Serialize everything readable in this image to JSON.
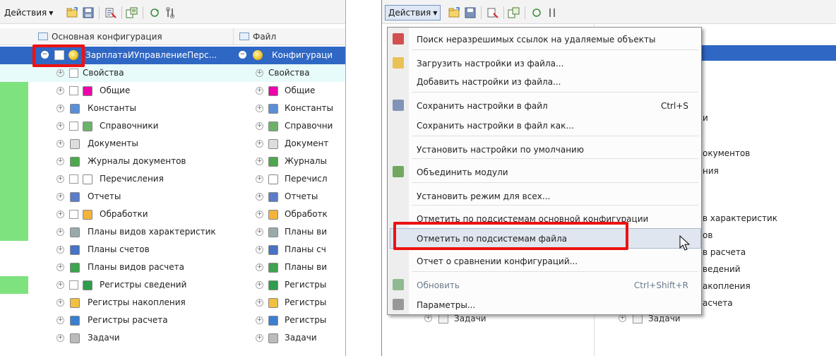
{
  "left": {
    "actions_label": "Действия",
    "col1_header": "Основная конфигурация",
    "col2_header": "Файл",
    "root_left": "ЗарплатаИУправлениеПерс...",
    "root_right": "Конфигураци",
    "rows": [
      {
        "left": "Свойства",
        "right": "Свойства",
        "icon": "properties-icon"
      },
      {
        "left": "Общие",
        "right": "Общие",
        "icon": "common-icon"
      },
      {
        "left": "Константы",
        "right": "Константы",
        "icon": "constants-icon"
      },
      {
        "left": "Справочники",
        "right": "Справочни",
        "icon": "catalogs-icon"
      },
      {
        "left": "Документы",
        "right": "Документ",
        "icon": "documents-icon"
      },
      {
        "left": "Журналы документов",
        "right": "Журналы",
        "icon": "document-journals-icon"
      },
      {
        "left": "Перечисления",
        "right": "Перечисл",
        "icon": "enums-icon"
      },
      {
        "left": "Отчеты",
        "right": "Отчеты",
        "icon": "reports-icon"
      },
      {
        "left": "Обработки",
        "right": "Обработк",
        "icon": "data-processors-icon"
      },
      {
        "left": "Планы видов характеристик",
        "right": "Планы ви",
        "icon": "char-types-icon"
      },
      {
        "left": "Планы счетов",
        "right": "Планы сч",
        "icon": "chart-of-accounts-icon"
      },
      {
        "left": "Планы видов расчета",
        "right": "Планы ви",
        "icon": "calc-types-icon"
      },
      {
        "left": "Регистры сведений",
        "right": "Регистры",
        "icon": "info-registers-icon"
      },
      {
        "left": "Регистры накопления",
        "right": "Регистры",
        "icon": "accum-registers-icon"
      },
      {
        "left": "Регистры расчета",
        "right": "Регистры",
        "icon": "calc-registers-icon"
      },
      {
        "left": "Задачи",
        "right": "Задачи",
        "icon": "tasks-icon"
      }
    ]
  },
  "right": {
    "actions_label": "Действия",
    "bg_fragments": [
      "и",
      "окументов",
      "ния",
      "в характеристик",
      "ов",
      "в расчета",
      "ведений",
      "акопления",
      "асчета"
    ],
    "bottom_row": "Задачи"
  },
  "menu": {
    "items": [
      {
        "label": "Поиск неразрешимых ссылок на удаляемые объекты",
        "shortcut": ""
      },
      {
        "label": "Загрузить настройки из файла...",
        "shortcut": ""
      },
      {
        "label": "Добавить настройки из файла...",
        "shortcut": ""
      },
      {
        "label": "Сохранить настройки в файл",
        "shortcut": "Ctrl+S"
      },
      {
        "label": "Сохранить настройки в файл как...",
        "shortcut": ""
      },
      {
        "label": "Установить настройки по умолчанию",
        "shortcut": ""
      },
      {
        "label": "Объединить модули",
        "shortcut": ""
      },
      {
        "label": "Установить режим для всех...",
        "shortcut": ""
      },
      {
        "label": "Отметить по подсистемам основной конфигурации",
        "shortcut": ""
      },
      {
        "label": "Отметить по подсистемам файла",
        "shortcut": ""
      },
      {
        "label": "Отчет о сравнении конфигураций...",
        "shortcut": ""
      },
      {
        "label": "Обновить",
        "shortcut": "Ctrl+Shift+R"
      },
      {
        "label": "Параметры...",
        "shortcut": ""
      }
    ]
  },
  "colors": {
    "highlight": "#ee1111",
    "selection": "#2f67c4",
    "alt_row": "#e8fbfb",
    "diff_strip": "#7ee37e"
  }
}
